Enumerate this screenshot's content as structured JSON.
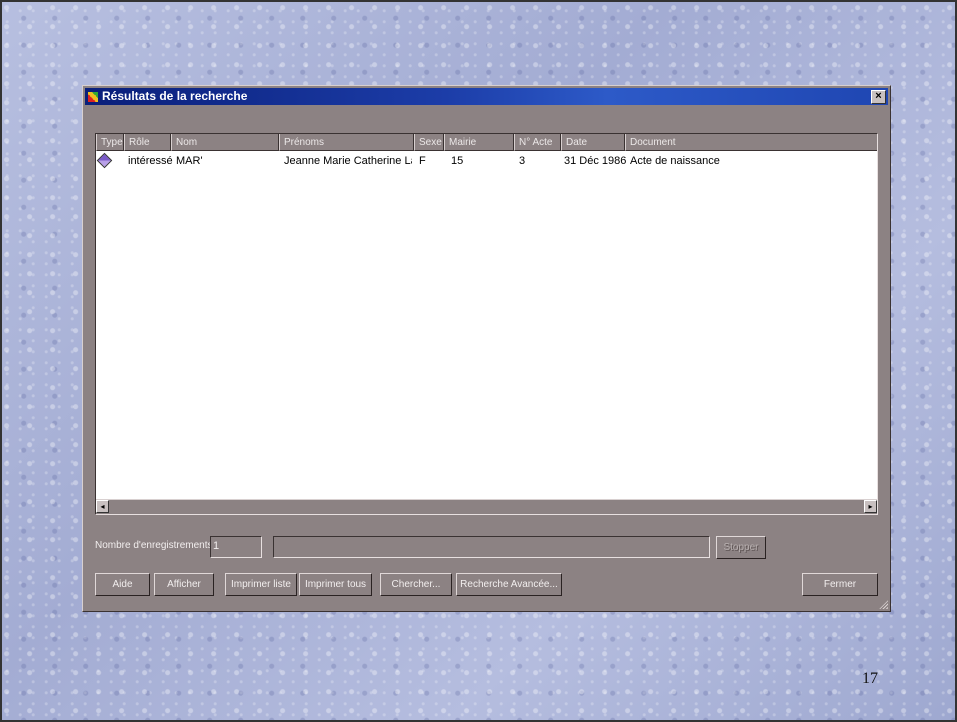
{
  "slide": {
    "page_number": "17"
  },
  "window": {
    "title": "Résultats de la recherche",
    "close_glyph": "×"
  },
  "table": {
    "columns": [
      "Type",
      "Rôle",
      "Nom",
      "Prénoms",
      "Sexe",
      "Mairie",
      "N° Acte",
      "Date",
      "Document"
    ],
    "rows": [
      {
        "type_icon": "record-icon",
        "role": "intéressé",
        "nom": "MAR'",
        "prenoms": "Jeanne Marie Catherine La...",
        "sexe": "F",
        "mairie": "15",
        "acte": "3",
        "date": "31 Déc 1986",
        "document": "Acte de naissance"
      }
    ]
  },
  "footer": {
    "count_label": "Nombre d'enregistrements :",
    "count_value": "1",
    "stop_button": "Stopper"
  },
  "buttons": {
    "aide": "Aide",
    "afficher": "Afficher",
    "imprimer_liste": "Imprimer liste",
    "imprimer_tous": "Imprimer tous",
    "chercher": "Chercher...",
    "recherche_avancee": "Recherche Avancée...",
    "fermer": "Fermer"
  }
}
